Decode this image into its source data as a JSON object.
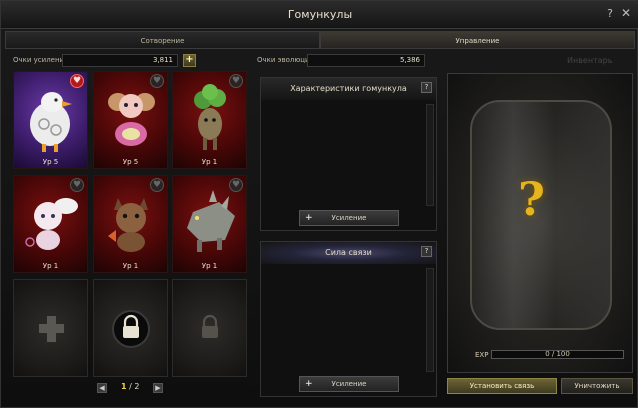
{
  "window": {
    "title": "Гомункулы",
    "help": "?",
    "close": "✕"
  },
  "tabs": [
    {
      "label": "Сотворение",
      "active": false
    },
    {
      "label": "Управление",
      "active": true
    }
  ],
  "stats": {
    "boost_label": "Очки усиления",
    "boost_value": "3,811",
    "boost_add": "+",
    "evolution_label": "Очки эволюции",
    "evolution_value": "5,386",
    "inventory_label": "Инвентарь"
  },
  "slots": [
    {
      "level": "Ур 5",
      "favorite": true,
      "bg": "purple",
      "creature": "chick"
    },
    {
      "level": "Ур 5",
      "favorite": false,
      "bg": "red",
      "creature": "fairy"
    },
    {
      "level": "Ур 1",
      "favorite": false,
      "bg": "red",
      "creature": "plant"
    },
    {
      "level": "Ур 1",
      "favorite": false,
      "bg": "red",
      "creature": "cherub"
    },
    {
      "level": "Ур 1",
      "favorite": false,
      "bg": "red",
      "creature": "beast"
    },
    {
      "level": "Ур 1",
      "favorite": false,
      "bg": "red",
      "creature": "dragon"
    }
  ],
  "empty_slots": [
    {
      "type": "add"
    },
    {
      "type": "locked"
    },
    {
      "type": "locked"
    }
  ],
  "pager": {
    "current": "1",
    "total": "/ 2",
    "prev": "◀",
    "next": "▶"
  },
  "characteristics": {
    "title": "Характеристики гомункула",
    "help": "?",
    "button": "Усиление",
    "plus": "+"
  },
  "bond": {
    "title": "Сила связи",
    "help": "?",
    "button": "Усиление",
    "plus": "+"
  },
  "vessel": {
    "question": "?",
    "exp_label": "EXP",
    "exp_value": "0 / 100",
    "exp_progress": 0
  },
  "actions": {
    "bind": "Установить связь",
    "destroy": "Уничтожить"
  }
}
